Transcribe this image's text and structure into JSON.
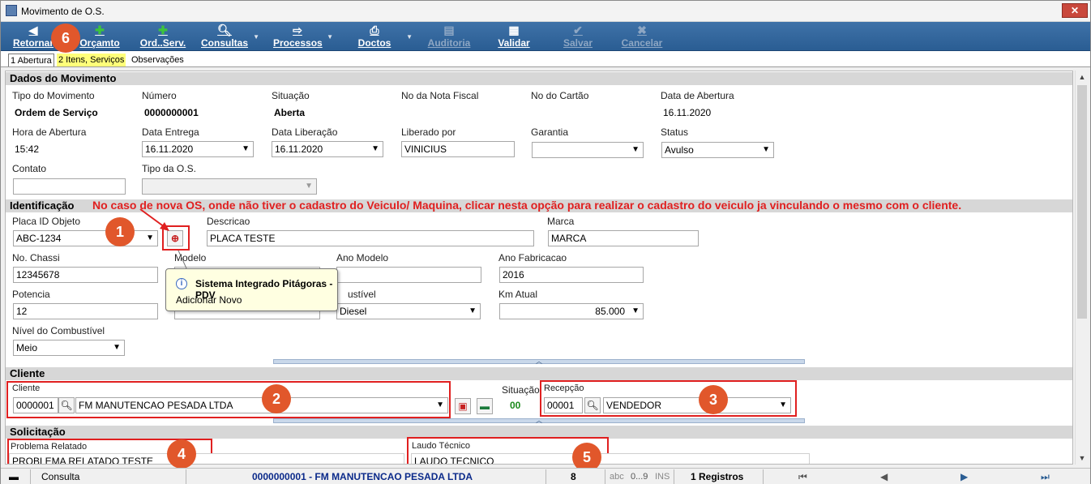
{
  "window": {
    "title": "Movimento de O.S.",
    "close": "✕"
  },
  "toolbar": {
    "retornar": "Retornar",
    "orcamento": "Orçamto",
    "ordserv": "Ord..Serv.",
    "consultas": "Consultas",
    "processos": "Processos",
    "doctos": "Doctos",
    "auditoria": "Auditoria",
    "validar": "Validar",
    "salvar": "Salvar",
    "cancelar": "Cancelar"
  },
  "tabs": {
    "abertura": "1 Abertura",
    "itens": "2 Itens, Serviços",
    "observacoes": "Observações"
  },
  "dados": {
    "header": "Dados do Movimento",
    "tipo_label": "Tipo do Movimento",
    "tipo_value": "Ordem de Serviço",
    "numero_label": "Número",
    "numero_value": "0000000001",
    "situacao_label": "Situação",
    "situacao_value": "Aberta",
    "nota_label": "No da Nota Fiscal",
    "cartao_label": "No do Cartão",
    "data_abertura_label": "Data de Abertura",
    "data_abertura_value": "16.11.2020",
    "hora_label": "Hora de Abertura",
    "hora_value": "15:42",
    "data_entrega_label": "Data Entrega",
    "data_entrega_value": "16.11.2020",
    "data_liberacao_label": "Data Liberação",
    "data_liberacao_value": "16.11.2020",
    "liberado_label": "Liberado por",
    "liberado_value": "VINICIUS",
    "garantia_label": "Garantia",
    "garantia_value": "",
    "status_label": "Status",
    "status_value": "Avulso",
    "contato_label": "Contato",
    "contato_value": "",
    "tipo_os_label": "Tipo da O.S.",
    "tipo_os_value": ""
  },
  "identificacao": {
    "header": "Identificação",
    "annotation": "No caso de nova OS, onde não tiver o cadastro do Veiculo/ Maquina, clicar nesta opção para realizar o cadastro do veiculo ja vinculando o mesmo com o cliente.",
    "placa_label": "Placa ID Objeto",
    "placa_value": "ABC-1234",
    "descricao_label": "Descricao",
    "descricao_value": "PLACA TESTE",
    "marca_label": "Marca",
    "marca_value": "MARCA",
    "chassi_label": "No. Chassi",
    "chassi_value": "12345678",
    "modelo_label": "Modelo",
    "ano_modelo_label": "Ano Modelo",
    "ano_modelo_value": "",
    "ano_fab_label": "Ano Fabricacao",
    "ano_fab_value": "2016",
    "potencia_label": "Potencia",
    "potencia_value": "12",
    "combustivel_label": "ustível",
    "combustivel_value": "Diesel",
    "km_label": "Km Atual",
    "km_value": "85.000",
    "nivel_label": "Nível do Combustível",
    "nivel_value": "Meio"
  },
  "tooltip": {
    "title": "Sistema Integrado Pitágoras - PDV",
    "body": "Adicionar Novo",
    "icon": "i"
  },
  "cliente": {
    "header": "Cliente",
    "cliente_label": "Cliente",
    "codigo": "0000001",
    "nome": "FM MANUTENCAO PESADA LTDA",
    "situacao_label": "Situação",
    "situacao_value": "00",
    "recepcao_label": "Recepção",
    "recepcao_codigo": "00001",
    "recepcao_nome": "VENDEDOR"
  },
  "solicitacao": {
    "header": "Solicitação",
    "problema_label": "Problema Relatado",
    "problema_value": "PROBLEMA RELATADO TESTE",
    "laudo_label": "Laudo Técnico",
    "laudo_value": "LAUDO TECNICO"
  },
  "badges": {
    "b1": "1",
    "b2": "2",
    "b3": "3",
    "b4": "4",
    "b5": "5",
    "b6": "6"
  },
  "status": {
    "mode": "Consulta",
    "record": "0000000001 - FM MANUTENCAO PESADA LTDA",
    "count": "8",
    "abc": "abc",
    "range": "0...9",
    "ins": "INS",
    "registros": "1 Registros"
  },
  "colors": {
    "toolbar": "#2f6399",
    "annotation": "#e02020",
    "badge": "#e1572b",
    "situacao": "#1a8a1a",
    "status_record": "#0b2a8a"
  }
}
